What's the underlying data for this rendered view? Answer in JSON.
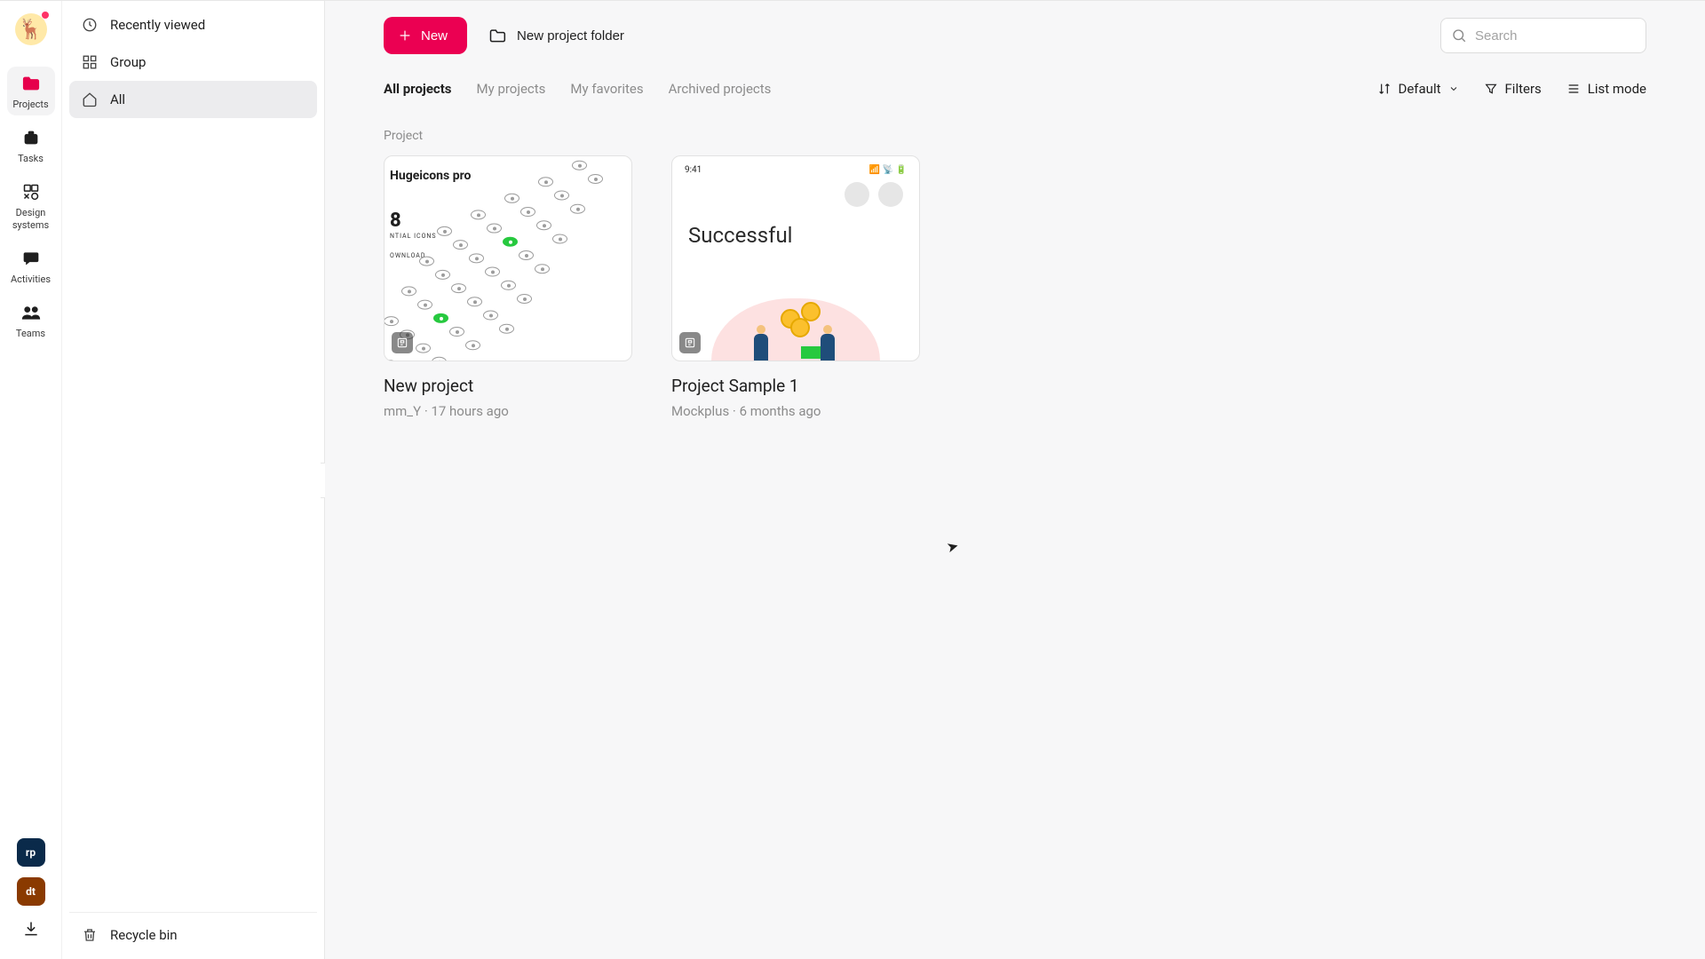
{
  "rail": {
    "items": [
      {
        "label": "Projects"
      },
      {
        "label": "Tasks"
      },
      {
        "label": "Design systems"
      },
      {
        "label": "Activities"
      },
      {
        "label": "Teams"
      }
    ],
    "tools": [
      {
        "label": "rp"
      },
      {
        "label": "dt"
      }
    ]
  },
  "sidebar": {
    "items": [
      {
        "label": "Recently viewed"
      },
      {
        "label": "Group"
      },
      {
        "label": "All"
      }
    ],
    "recycle": "Recycle bin"
  },
  "toolbar": {
    "new_label": "New",
    "folder_label": "New project folder",
    "search_placeholder": "Search"
  },
  "tabs": {
    "items": [
      {
        "label": "All projects"
      },
      {
        "label": "My projects"
      },
      {
        "label": "My favorites"
      },
      {
        "label": "Archived projects"
      }
    ],
    "sort_label": "Default",
    "filters_label": "Filters",
    "mode_label": "List mode"
  },
  "section": {
    "label": "Project"
  },
  "projects": [
    {
      "title": "New project",
      "author": "mm_Y",
      "sep": " · ",
      "time": "17 hours ago",
      "thumb": {
        "caption": "Hugeicons pro",
        "sub1": "NTIAL ICONS",
        "sub2": "OWNLOAD",
        "big": "8"
      }
    },
    {
      "title": "Project Sample 1",
      "author": "Mockplus",
      "sep": " · ",
      "time": "6 months ago",
      "thumb": {
        "clock": "9:41",
        "heading": "Successful"
      }
    }
  ]
}
